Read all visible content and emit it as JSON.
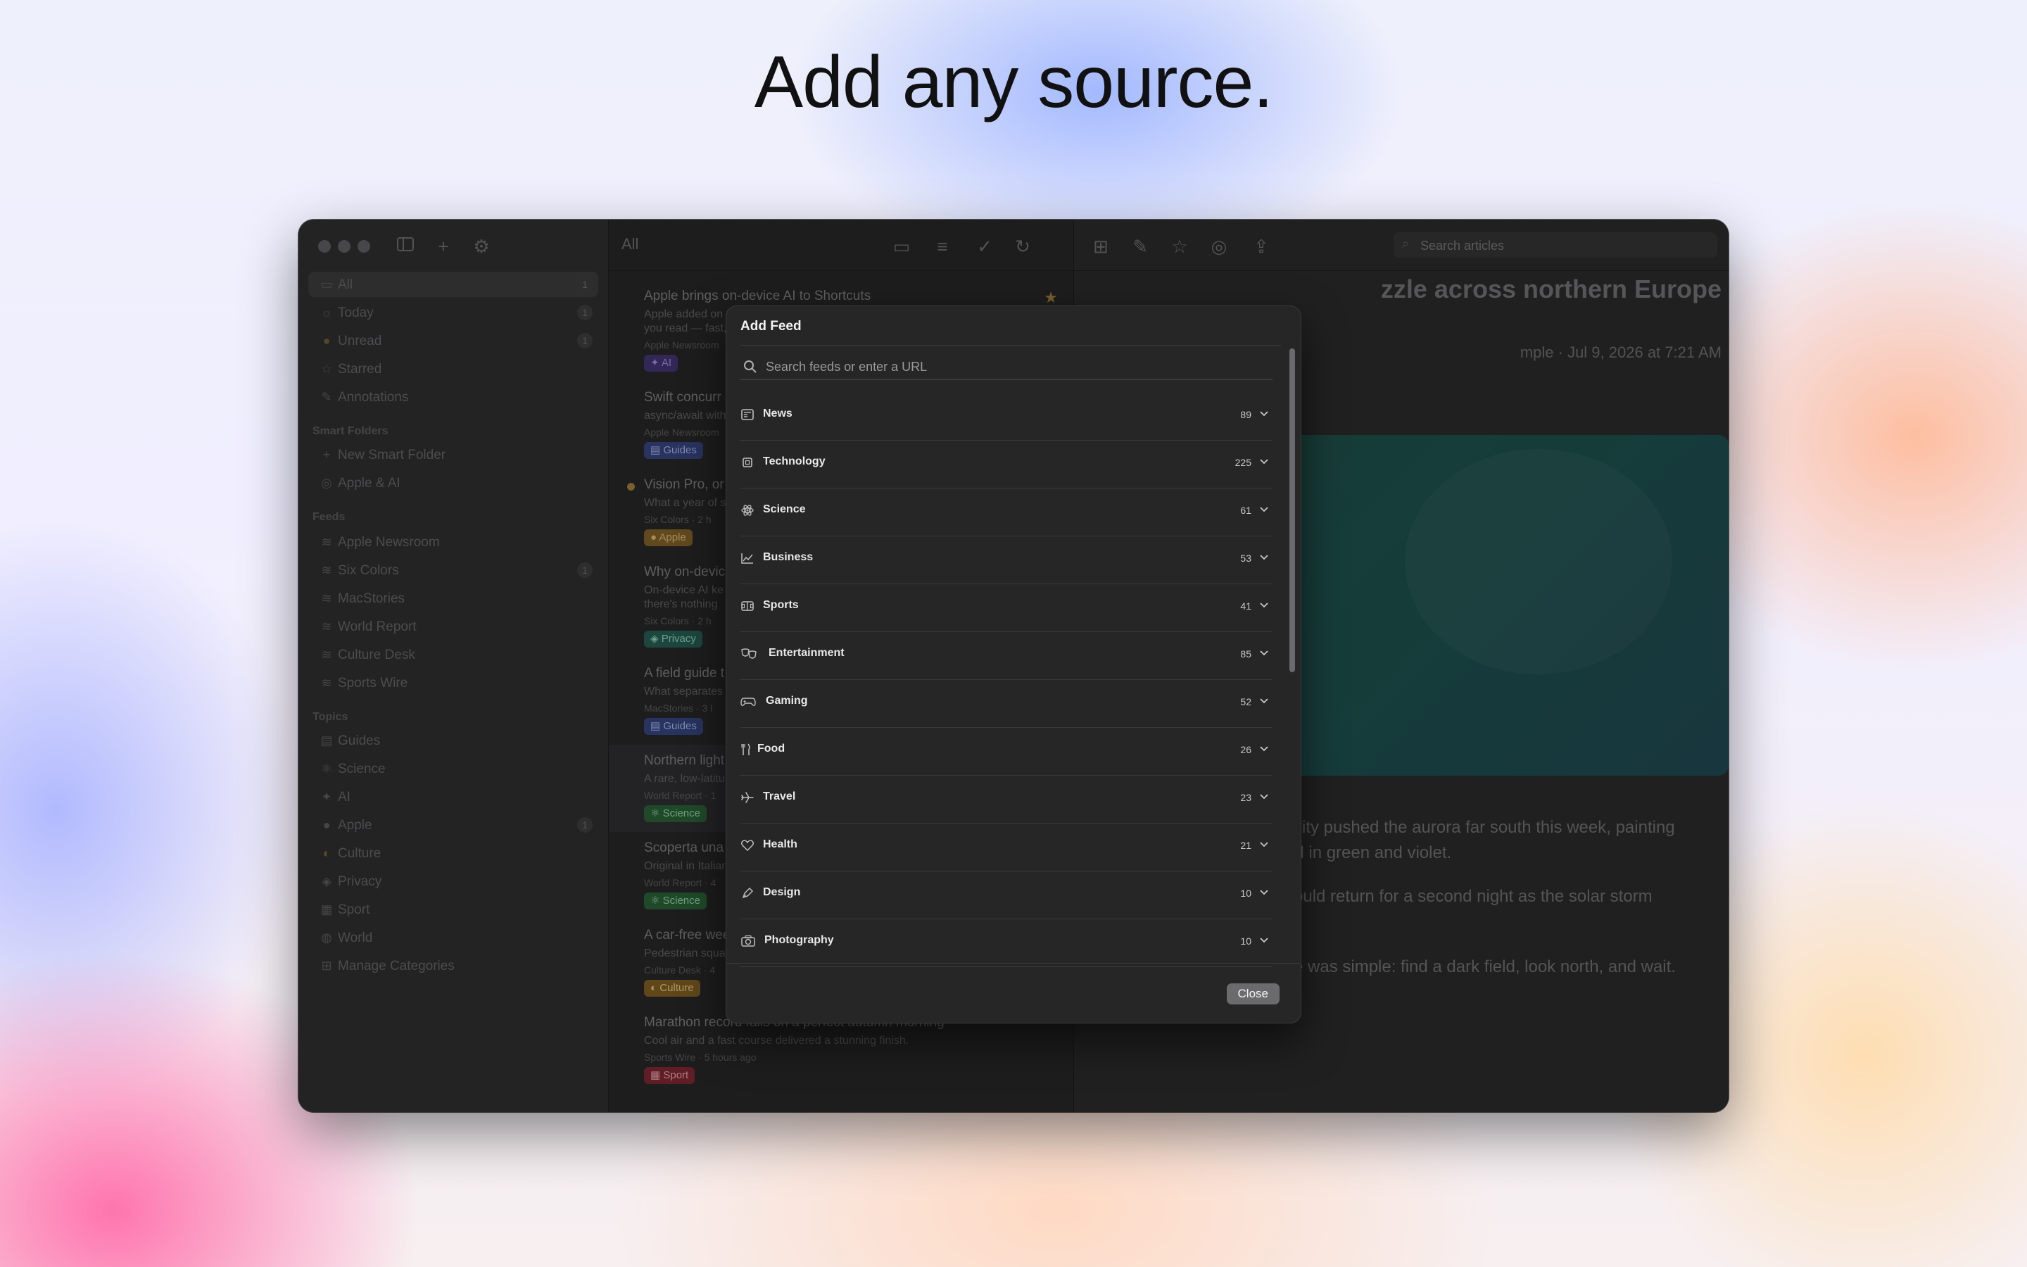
{
  "headline": "Add any source.",
  "sidebar": {
    "items": [
      {
        "label": "All",
        "count": "1"
      },
      {
        "label": "Today",
        "count": "1"
      },
      {
        "label": "Unread",
        "count": "1"
      },
      {
        "label": "Starred",
        "count": ""
      },
      {
        "label": "Annotations",
        "count": ""
      }
    ],
    "smart_folders_header": "Smart Folders",
    "smart_folders": [
      {
        "label": "New Smart Folder"
      },
      {
        "label": "Apple & AI"
      }
    ],
    "feeds_header": "Feeds",
    "feeds": [
      {
        "label": "Apple Newsroom",
        "count": ""
      },
      {
        "label": "Six Colors",
        "count": "1"
      },
      {
        "label": "MacStories",
        "count": ""
      },
      {
        "label": "World Report",
        "count": ""
      },
      {
        "label": "Culture Desk",
        "count": ""
      },
      {
        "label": "Sports Wire",
        "count": ""
      }
    ],
    "topics_header": "Topics",
    "topics": [
      {
        "label": "Guides",
        "count": ""
      },
      {
        "label": "Science",
        "count": ""
      },
      {
        "label": "AI",
        "count": ""
      },
      {
        "label": "Apple",
        "count": "1"
      },
      {
        "label": "Culture",
        "count": ""
      },
      {
        "label": "Privacy",
        "count": ""
      },
      {
        "label": "Sport",
        "count": ""
      },
      {
        "label": "World",
        "count": ""
      },
      {
        "label": "Manage Categories",
        "count": ""
      }
    ]
  },
  "list": {
    "title": "All",
    "articles": [
      {
        "title": "Apple brings on-device AI to Shortcuts",
        "line1": "Apple added on",
        "line2": "you read — fast,",
        "meta": "Apple Newsroom",
        "tag": "AI"
      },
      {
        "title": "Swift concurr",
        "line1": "async/await with",
        "line2": "",
        "meta": "Apple Newsroom",
        "tag": "Guides"
      },
      {
        "title": "Vision Pro, or",
        "line1": "What a year of s",
        "line2": "",
        "meta": "Six Colors · 2 h",
        "tag": "Apple"
      },
      {
        "title": "Why on-devic",
        "line1": "On-device AI ke",
        "line2": "there's nothing",
        "meta": "Six Colors · 2 h",
        "tag": "Privacy"
      },
      {
        "title": "A field guide t",
        "line1": "What separates",
        "line2": "",
        "meta": "MacStories · 3 l",
        "tag": "Guides"
      },
      {
        "title": "Northern light",
        "line1": "A rare, low-latitu",
        "line2": "",
        "meta": "World Report · 1",
        "tag": "Science"
      },
      {
        "title": "Scoperta una",
        "line1": "Original in Italian",
        "line2": "",
        "meta": "World Report · 4",
        "tag": "Science"
      },
      {
        "title": "A car-free wee",
        "line1": "Pedestrian squa",
        "line2": "",
        "meta": "Culture Desk · 4",
        "tag": "Culture"
      },
      {
        "title": "Marathon record falls on a perfect autumn morning",
        "line1": "Cool air and a fast course delivered a stunning finish.",
        "line2": "",
        "meta": "Sports Wire · 5 hours ago",
        "tag": "Sport"
      }
    ]
  },
  "detail": {
    "search_placeholder": "Search articles",
    "title": "zzle across northern Europe",
    "meta": "mple · Jul 9, 2026 at 7:21 AM",
    "body": [
      "tivity pushed the aurora far south this week, painting",
      "nd in green and violet.",
      "could return for a second night as the solar storm",
      "ce was simple: find a dark field, look north, and wait."
    ]
  },
  "modal": {
    "title": "Add Feed",
    "search_placeholder": "Search feeds or enter a URL",
    "categories": [
      {
        "label": "News",
        "count": "89",
        "icon": "newspaper-icon"
      },
      {
        "label": "Technology",
        "count": "225",
        "icon": "cpu-icon"
      },
      {
        "label": "Science",
        "count": "61",
        "icon": "atom-icon"
      },
      {
        "label": "Business",
        "count": "53",
        "icon": "chart-line-icon"
      },
      {
        "label": "Sports",
        "count": "41",
        "icon": "sports-court-icon"
      },
      {
        "label": "Entertainment",
        "count": "85",
        "icon": "theater-masks-icon"
      },
      {
        "label": "Gaming",
        "count": "52",
        "icon": "gamepad-icon"
      },
      {
        "label": "Food",
        "count": "26",
        "icon": "fork-knife-icon"
      },
      {
        "label": "Travel",
        "count": "23",
        "icon": "airplane-icon"
      },
      {
        "label": "Health",
        "count": "21",
        "icon": "heart-icon"
      },
      {
        "label": "Design",
        "count": "10",
        "icon": "pen-nib-icon"
      },
      {
        "label": "Photography",
        "count": "10",
        "icon": "camera-icon"
      }
    ],
    "close_label": "Close"
  },
  "colors": {
    "tag_ai": "#4b3a8c",
    "tag_guides": "#3a4c8c",
    "tag_apple": "#8c6a2a",
    "tag_privacy": "#2a6a5a",
    "tag_science": "#2e6a3e",
    "tag_culture": "#8a6a2c",
    "tag_sport": "#8c2a32"
  }
}
